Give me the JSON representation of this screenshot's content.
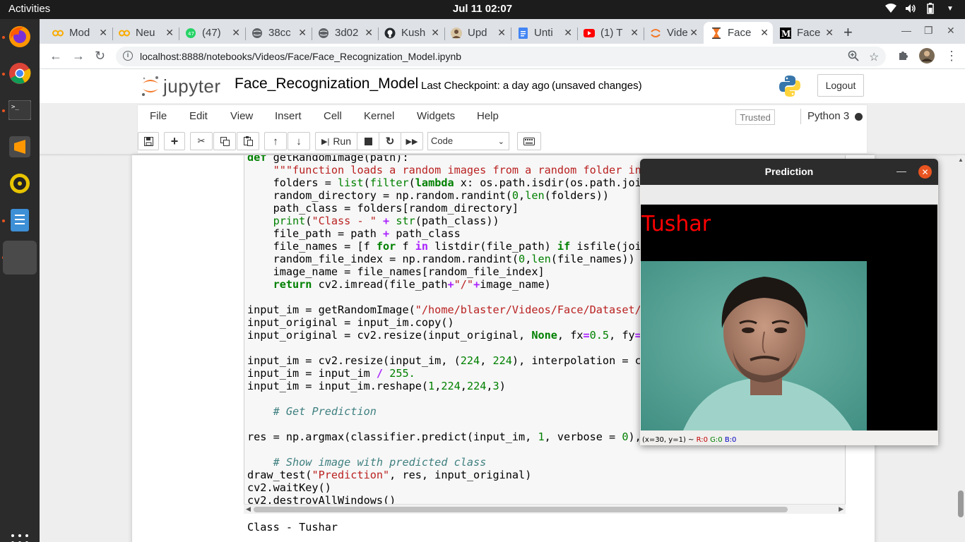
{
  "topbar": {
    "activities": "Activities",
    "clock": "Jul 11  02:07"
  },
  "tabs": [
    {
      "label": "Mod",
      "icon": "colab-icon"
    },
    {
      "label": "Neu",
      "icon": "colab-icon"
    },
    {
      "label": "(47)",
      "icon": "whatsapp-icon"
    },
    {
      "label": "38cc",
      "icon": "globe-icon"
    },
    {
      "label": "3d02",
      "icon": "globe-icon"
    },
    {
      "label": "Kush",
      "icon": "github-icon"
    },
    {
      "label": "Upd",
      "icon": "avatar-icon"
    },
    {
      "label": "Unti",
      "icon": "docs-icon"
    },
    {
      "label": "(1) T",
      "icon": "youtube-icon"
    },
    {
      "label": "Vide",
      "icon": "jupyter-icon"
    },
    {
      "label": "Face",
      "icon": "hourglass-icon"
    },
    {
      "label": "Face",
      "icon": "medium-icon"
    }
  ],
  "browser": {
    "url": "localhost:8888/notebooks/Videos/Face/Face_Recognization_Model.ipynb"
  },
  "jupyter": {
    "logo_text": "jupyter",
    "notebook_title": "Face_Recognization_Model",
    "checkpoint": "Last Checkpoint: a day ago",
    "unsaved": "(unsaved changes)",
    "logout": "Logout",
    "menu": [
      "File",
      "Edit",
      "View",
      "Insert",
      "Cell",
      "Kernel",
      "Widgets",
      "Help"
    ],
    "trusted": "Trusted",
    "kernel": "Python 3",
    "run_label": "Run",
    "cell_type": "Code"
  },
  "cell": {
    "output": "Class - Tushar"
  },
  "prediction_window": {
    "title": "Prediction",
    "name_label": "Tushar",
    "status": "(x=30, y=1) ~",
    "status_r": "R:0",
    "status_g": "G:0",
    "status_b": "B:0"
  }
}
